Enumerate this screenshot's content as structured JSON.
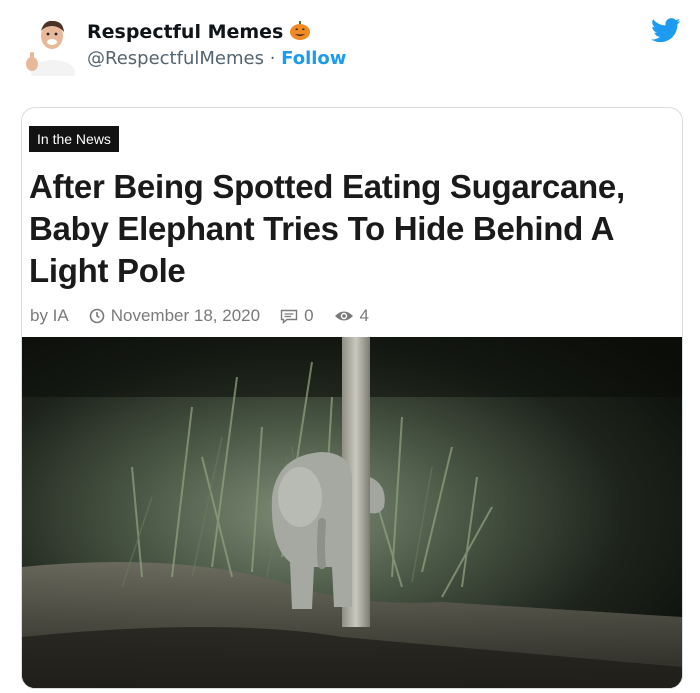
{
  "tweet": {
    "display_name": "Respectful Memes",
    "handle": "@RespectfulMemes",
    "separator": "·",
    "follow_label": "Follow",
    "accent_color": "#1d9bf0"
  },
  "article": {
    "tag": "In the News",
    "headline": "After Being Spotted Eating Sugarcane, Baby Elephant Tries To Hide Behind A Light Pole",
    "author": "by IA",
    "date": "November 18, 2020",
    "comments": "0",
    "views": "4"
  },
  "icons": {
    "avatar": "avatar-thumbs-up-man",
    "pumpkin": "jack-o-lantern-emoji",
    "twitter": "twitter-bird-icon",
    "clock": "clock-icon",
    "comment": "comment-icon",
    "views": "eye-icon"
  }
}
